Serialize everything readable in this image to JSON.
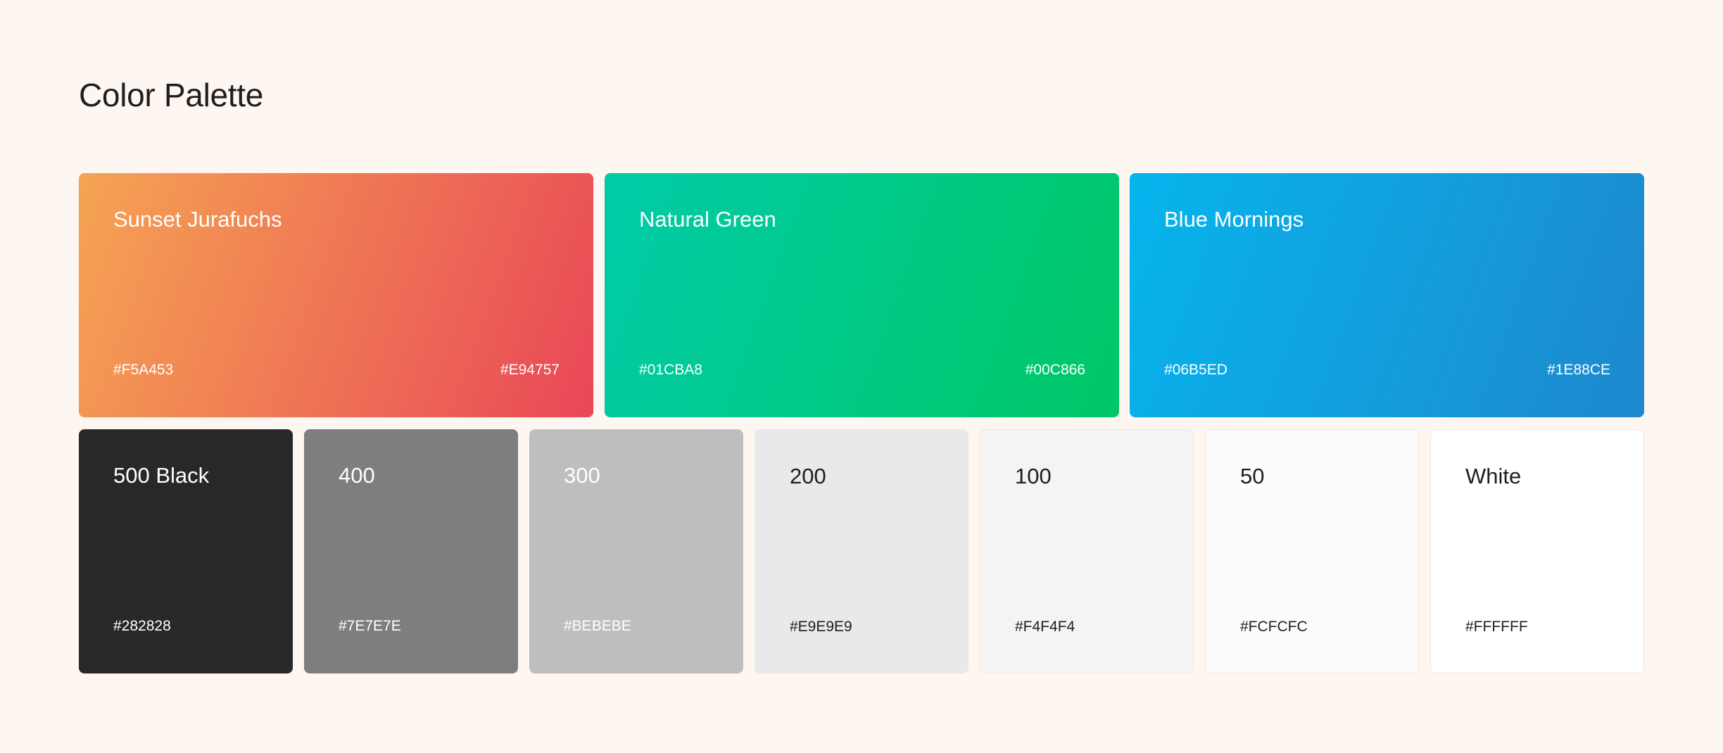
{
  "page": {
    "title": "Color Palette"
  },
  "gradients": [
    {
      "name": "Sunset Jurafuchs",
      "from": "#F5A453",
      "to": "#E94757"
    },
    {
      "name": "Natural Green",
      "from": "#01CBA8",
      "to": "#00C866"
    },
    {
      "name": "Blue Mornings",
      "from": "#06B5ED",
      "to": "#1E88CE"
    }
  ],
  "grays": [
    {
      "name": "500 Black",
      "hex": "#282828",
      "text_color": "#FFFFFF"
    },
    {
      "name": "400",
      "hex": "#7E7E7E",
      "text_color": "#FFFFFF"
    },
    {
      "name": "300",
      "hex": "#BEBEBE",
      "text_color": "#FFFFFF"
    },
    {
      "name": "200",
      "hex": "#E9E9E9",
      "text_color": "#1E1E1E"
    },
    {
      "name": "100",
      "hex": "#F4F4F4",
      "text_color": "#1E1E1E"
    },
    {
      "name": "50",
      "hex": "#FCFCFC",
      "text_color": "#1E1E1E"
    },
    {
      "name": "White",
      "hex": "#FFFFFF",
      "text_color": "#1E1E1E"
    }
  ],
  "colors": {
    "background": "#FEF6F0",
    "title_text": "#1E1E1E"
  }
}
